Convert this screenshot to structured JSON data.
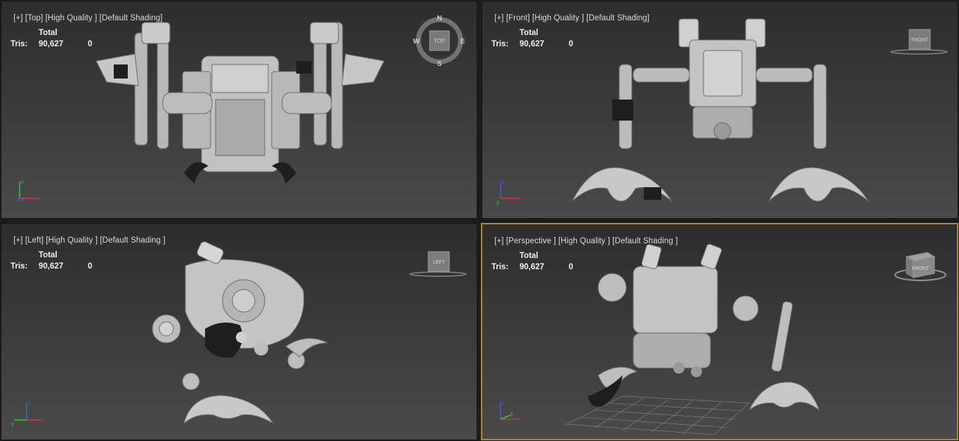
{
  "viewports": [
    {
      "id": "top",
      "label": {
        "plus": "[+]",
        "view": "[Top]",
        "quality": "[High Quality ]",
        "shading": "[Default Shading]"
      },
      "stats": {
        "header": "Total",
        "tris_label": "Tris:",
        "tris_value": "90,627",
        "tris_selected": "0"
      },
      "gizmo": {
        "type": "compass",
        "text": "TOP",
        "n": "N",
        "s": "S",
        "e": "E",
        "w": "W"
      },
      "axes": {
        "up": "y",
        "right": "x",
        "depth": "z"
      }
    },
    {
      "id": "front",
      "label": {
        "plus": "[+]",
        "view": "[Front]",
        "quality": "[High Quality ]",
        "shading": "[Default Shading]"
      },
      "stats": {
        "header": "Total",
        "tris_label": "Tris:",
        "tris_value": "90,627",
        "tris_selected": "0"
      },
      "gizmo": {
        "type": "cube",
        "text": "FRONT"
      },
      "axes": {
        "up": "z",
        "right": "x",
        "depth": "y"
      }
    },
    {
      "id": "left",
      "label": {
        "plus": "[+]",
        "view": "[Left]",
        "quality": "[High Quality ]",
        "shading": "[Default Shading ]"
      },
      "stats": {
        "header": "Total",
        "tris_label": "Tris:",
        "tris_value": "90,627",
        "tris_selected": "0"
      },
      "gizmo": {
        "type": "cube",
        "text": "LEFT"
      },
      "axes": {
        "up": "z",
        "right": "x",
        "depth": "y"
      }
    },
    {
      "id": "perspective",
      "active": true,
      "label": {
        "plus": "[+]",
        "view": "[Perspective ]",
        "quality": "[High Quality ]",
        "shading": "[Default Shading ]"
      },
      "stats": {
        "header": "Total",
        "tris_label": "Tris:",
        "tris_value": "90,627",
        "tris_selected": "0"
      },
      "gizmo": {
        "type": "cube3d",
        "text": "FRONT"
      },
      "axes": {
        "up": "z",
        "right": "x",
        "depth": "y"
      }
    }
  ],
  "colors": {
    "active_border": "#b08a2e",
    "axis_x": "#d23a3a",
    "axis_y": "#3fbf3f",
    "axis_z": "#4060e0",
    "model": "#bdbdbd"
  }
}
